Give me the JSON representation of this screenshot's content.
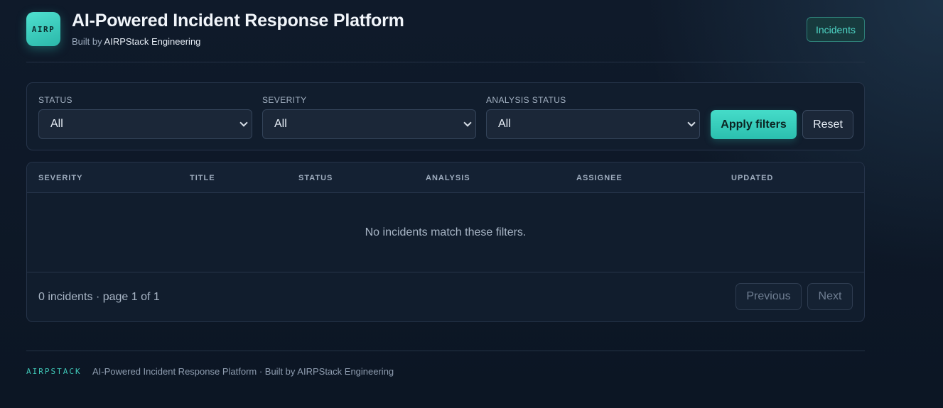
{
  "header": {
    "logo_text": "AIRP",
    "title": "AI-Powered Incident Response Platform",
    "subtitle_prefix": "Built by",
    "subtitle_org": "AIRPStack Engineering",
    "nav_incidents": "Incidents"
  },
  "filters": {
    "status_label": "STATUS",
    "status_value": "All",
    "severity_label": "SEVERITY",
    "severity_value": "All",
    "analysis_label": "ANALYSIS STATUS",
    "analysis_value": "All",
    "apply_label": "Apply filters",
    "reset_label": "Reset"
  },
  "table": {
    "columns": [
      "SEVERITY",
      "TITLE",
      "STATUS",
      "ANALYSIS",
      "ASSIGNEE",
      "UPDATED"
    ],
    "empty_message": "No incidents match these filters.",
    "summary": "0 incidents · page 1 of 1",
    "prev_label": "Previous",
    "next_label": "Next"
  },
  "footer": {
    "brand": "AIRPSTACK",
    "text": "AI-Powered Incident Response Platform · Built by AIRPStack Engineering"
  },
  "colors": {
    "accent": "#3fd2c1",
    "background": "#0d1726",
    "card": "#111d2d"
  }
}
